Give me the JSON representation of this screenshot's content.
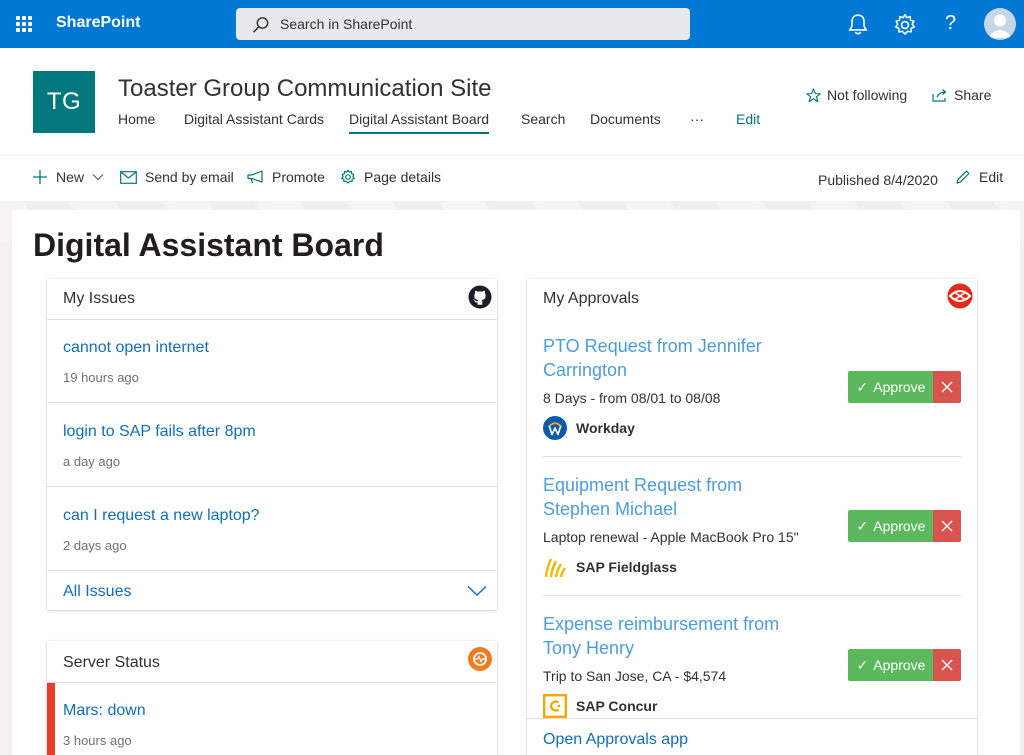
{
  "suitebar": {
    "app_name": "SharePoint",
    "search_placeholder": "Search in SharePoint",
    "icons": [
      "waffle-icon",
      "bell-icon",
      "gear-icon",
      "help-icon",
      "avatar"
    ]
  },
  "site": {
    "logo_text": "TG",
    "title": "Toaster Group Communication Site",
    "nav": [
      "Home",
      "Digital Assistant Cards",
      "Digital Assistant Board",
      "Search",
      "Documents",
      "···",
      "Edit"
    ],
    "follow_label": "Not following",
    "share_label": "Share"
  },
  "commandbar": {
    "new_label": "New",
    "send_label": "Send by email",
    "promote_label": "Promote",
    "details_label": "Page details",
    "published": "Published 8/4/2020",
    "edit_label": "Edit"
  },
  "page": {
    "title": "Digital Assistant Board"
  },
  "issues": {
    "title": "My Issues",
    "items": [
      {
        "title": "cannot open internet",
        "time": "19 hours ago"
      },
      {
        "title": "login to SAP fails after 8pm",
        "time": "a day ago"
      },
      {
        "title": "can I request a new laptop?",
        "time": "2 days ago"
      }
    ],
    "footer": "All Issues"
  },
  "approvals": {
    "title": "My Approvals",
    "items": [
      {
        "title": "PTO Request from Jennifer Carrington",
        "subtitle": "8 Days - from 08/01 to 08/08",
        "source": "Workday"
      },
      {
        "title": "Equipment Request from Stephen Michael",
        "subtitle": "Laptop renewal - Apple MacBook Pro 15\"",
        "source": "SAP Fieldglass"
      },
      {
        "title": "Expense reimbursement from Tony Henry",
        "subtitle": "Trip to San Jose, CA - $4,574",
        "source": "SAP Concur"
      }
    ],
    "approve_label": "Approve",
    "footer": "Open Approvals app"
  },
  "server": {
    "title": "Server Status",
    "items": [
      {
        "name": "Mars: down",
        "time": "3 hours ago"
      }
    ]
  },
  "colors": {
    "suitebar": "#0078d4",
    "theme": "#03787c",
    "link": "#106ebe",
    "approve": "#5cb85c",
    "reject": "#d9534f",
    "down": "#e83e2a"
  }
}
